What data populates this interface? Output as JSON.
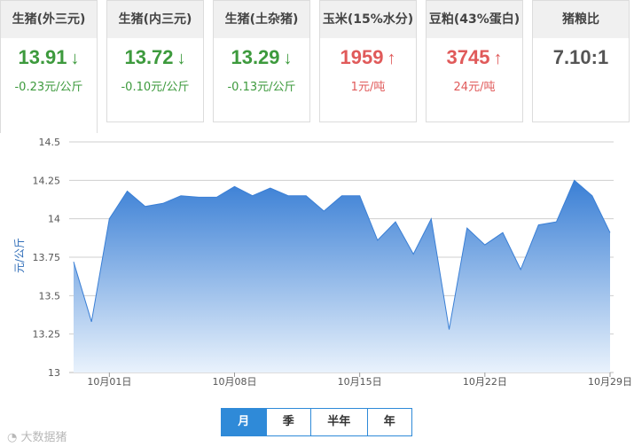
{
  "cards": [
    {
      "title": "生猪(外三元)",
      "price": "13.91",
      "dir": "down",
      "change": "-0.23元/公斤"
    },
    {
      "title": "生猪(内三元)",
      "price": "13.72",
      "dir": "down",
      "change": "-0.10元/公斤"
    },
    {
      "title": "生猪(土杂猪)",
      "price": "13.29",
      "dir": "down",
      "change": "-0.13元/公斤"
    },
    {
      "title": "玉米(15%水分)",
      "price": "1959",
      "dir": "up",
      "change": "1元/吨"
    },
    {
      "title": "豆粕(43%蛋白)",
      "price": "3745",
      "dir": "up",
      "change": "24元/吨"
    },
    {
      "title": "猪粮比",
      "price": "7.10:1",
      "dir": "none",
      "change": ""
    }
  ],
  "arrows": {
    "down": "↓",
    "up": "↑"
  },
  "colors": {
    "down": "#3d9a3d",
    "up": "#e05a5a",
    "area_top": "#3a7fd5",
    "area_bottom": "#e9f2fc",
    "tab_active": "#2f8ad8"
  },
  "chart_data": {
    "type": "area",
    "ylabel": "元/公斤",
    "ylim": [
      13,
      14.5
    ],
    "yticks": [
      "13",
      "13.25",
      "13.5",
      "13.75",
      "14",
      "14.25",
      "14.5"
    ],
    "xtick_labels": [
      {
        "index": 2,
        "label": "10月01日"
      },
      {
        "index": 9,
        "label": "10月08日"
      },
      {
        "index": 16,
        "label": "10月15日"
      },
      {
        "index": 23,
        "label": "10月22日"
      },
      {
        "index": 30,
        "label": "10月29日"
      }
    ],
    "x": [
      "9/29",
      "9/30",
      "10/01",
      "10/02",
      "10/03",
      "10/04",
      "10/05",
      "10/06",
      "10/07",
      "10/08",
      "10/09",
      "10/10",
      "10/11",
      "10/12",
      "10/13",
      "10/14",
      "10/15",
      "10/16",
      "10/17",
      "10/18",
      "10/19",
      "10/20",
      "10/21",
      "10/22",
      "10/23",
      "10/24",
      "10/25",
      "10/26",
      "10/27",
      "10/28",
      "10/29"
    ],
    "values": [
      13.72,
      13.33,
      14.0,
      14.18,
      14.08,
      14.1,
      14.15,
      14.14,
      14.14,
      14.21,
      14.15,
      14.2,
      14.15,
      14.15,
      14.05,
      14.15,
      14.15,
      13.86,
      13.98,
      13.77,
      14.0,
      13.28,
      13.94,
      13.83,
      13.91,
      13.67,
      13.96,
      13.98,
      14.25,
      14.15,
      13.91
    ],
    "grid": true,
    "legend": "none"
  },
  "period_tabs": [
    {
      "label": "月",
      "selected": true
    },
    {
      "label": "季",
      "selected": false
    },
    {
      "label": "半年",
      "selected": false
    },
    {
      "label": "年",
      "selected": false
    }
  ],
  "watermark": "大数据猪"
}
